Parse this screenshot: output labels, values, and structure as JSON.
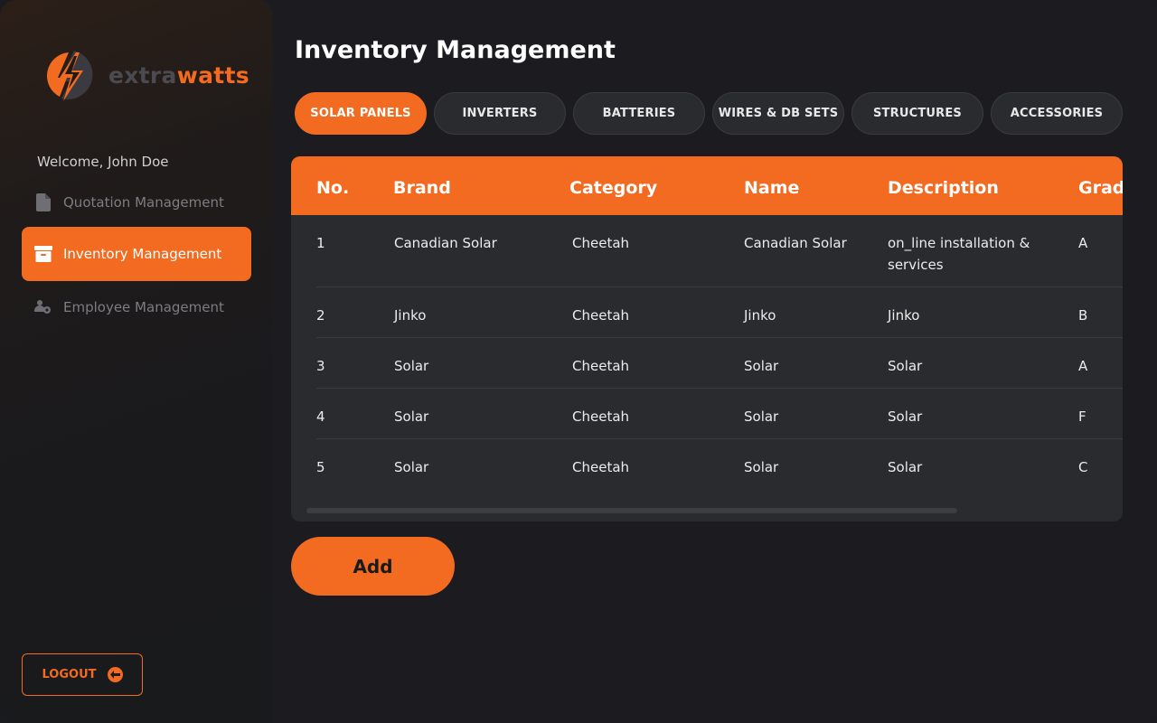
{
  "brand": {
    "name_part1": "extra",
    "name_part2": "watts",
    "accent_color": "#f26b21"
  },
  "sidebar": {
    "welcome": "Welcome, John Doe",
    "items": [
      {
        "label": "Quotation Management",
        "icon": "document-icon",
        "active": false
      },
      {
        "label": "Inventory Management",
        "icon": "archive-box-icon",
        "active": true
      },
      {
        "label": "Employee Management",
        "icon": "users-gear-icon",
        "active": false
      }
    ],
    "logout_label": "LOGOUT"
  },
  "main": {
    "title": "Inventory Management",
    "tabs": [
      {
        "label": "SOLAR PANELS",
        "active": true
      },
      {
        "label": "INVERTERS",
        "active": false
      },
      {
        "label": "BATTERIES",
        "active": false
      },
      {
        "label": "WIRES & DB SETS",
        "active": false
      },
      {
        "label": "STRUCTURES",
        "active": false
      },
      {
        "label": "ACCESSORIES",
        "active": false
      }
    ],
    "table": {
      "columns": [
        "No.",
        "Brand",
        "Category",
        "Name",
        "Description",
        "Grad"
      ],
      "rows": [
        [
          "1",
          "Canadian Solar",
          "Cheetah",
          "Canadian Solar",
          "on_line installation & services",
          "A"
        ],
        [
          "2",
          "Jinko",
          "Cheetah",
          "Jinko",
          "Jinko",
          "B"
        ],
        [
          "3",
          "Solar",
          "Cheetah",
          "Solar",
          "Solar",
          "A"
        ],
        [
          "4",
          "Solar",
          "Cheetah",
          "Solar",
          "Solar",
          "F"
        ],
        [
          "5",
          "Solar",
          "Cheetah",
          "Solar",
          "Solar",
          "C"
        ]
      ]
    },
    "add_label": "Add"
  }
}
